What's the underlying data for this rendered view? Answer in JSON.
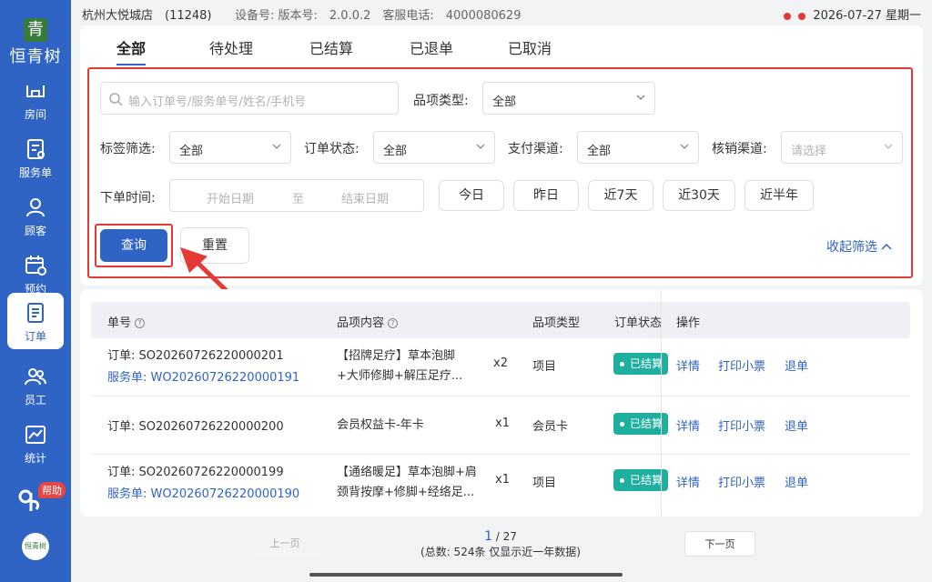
{
  "app": {
    "logo_mark": "青",
    "logo_text": "恒青树",
    "bottom_logo_text": "恒青树"
  },
  "sidebar": {
    "items": [
      {
        "label": "房间",
        "icon": "room-icon"
      },
      {
        "label": "服务单",
        "icon": "service-order-icon"
      },
      {
        "label": "顾客",
        "icon": "customer-icon"
      },
      {
        "label": "预约",
        "icon": "appointment-icon"
      },
      {
        "label": "订单",
        "icon": "order-icon",
        "active": true
      },
      {
        "label": "员工",
        "icon": "staff-icon"
      },
      {
        "label": "统计",
        "icon": "statistics-icon"
      }
    ],
    "help_label": "帮助"
  },
  "statusbar": {
    "store": "杭州大悦城店　(11248)",
    "device": "设备号: 版本号:　2.0.0.2　客服电话:　4000080629",
    "datetime": "2026-07-27 星期一"
  },
  "tabs": [
    "全部",
    "待处理",
    "已结算",
    "已退单",
    "已取消"
  ],
  "filters": {
    "search_placeholder": "输入订单号/服务单号/姓名/手机号",
    "item_type_label": "品项类型:",
    "item_type_value": "全部",
    "tag_label": "标签筛选:",
    "tag_value": "全部",
    "order_status_label": "订单状态:",
    "order_status_value": "全部",
    "pay_channel_label": "支付渠道:",
    "pay_channel_value": "全部",
    "verify_channel_label": "核销渠道:",
    "verify_channel_placeholder": "请选择",
    "time_label": "下单时间:",
    "start_date_placeholder": "开始日期",
    "to": "至",
    "end_date_placeholder": "结束日期",
    "quick_ranges": [
      "今日",
      "昨日",
      "近7天",
      "近30天",
      "近半年"
    ],
    "query_label": "查询",
    "reset_label": "重置",
    "collapse_label": "收起筛选"
  },
  "table": {
    "headers": {
      "order_no": "单号",
      "content": "品项内容",
      "type": "品项类型",
      "status": "订单状态",
      "ops": "操作"
    },
    "rows": [
      {
        "order": "订单: SO20260726220000201",
        "service": "服务单: WO20260726220000191",
        "content_line1": "【招牌足疗】草本泡脚",
        "content_line2": "+大师修脚+解压足疗...",
        "qty": "x2",
        "type": "项目",
        "status": "已结算"
      },
      {
        "order": "订单: SO20260726220000200",
        "service": "",
        "content_line1": "会员权益卡-年卡",
        "content_line2": "",
        "qty": "x1",
        "type": "会员卡",
        "status": "已结算"
      },
      {
        "order": "订单: SO20260726220000199",
        "service": "服务单: WO20260726220000190",
        "content_line1": "【通络暖足】草本泡脚+肩",
        "content_line2": "颈背按摩+修脚+经络足...",
        "qty": "x1",
        "type": "项目",
        "status": "已结算"
      }
    ],
    "ops": {
      "detail": "详情",
      "print": "打印小票",
      "refund": "退单"
    }
  },
  "pagination": {
    "prev": "上一页",
    "next": "下一页",
    "current": "1",
    "separator": " / ",
    "total_pages": "27",
    "summary": "(总数: 524条 仅显示近一年数据)"
  },
  "colors": {
    "primary": "#2f64c5",
    "highlight": "#e53935",
    "status_settled": "#1faf9f"
  }
}
